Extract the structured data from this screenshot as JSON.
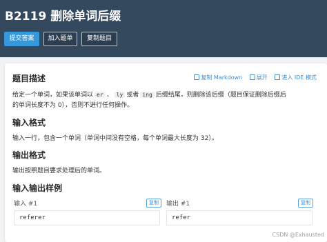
{
  "header": {
    "title": "B2119 删除单词后缀",
    "buttons": {
      "submit": "提交答案",
      "add_to_list": "加入题单",
      "copy_problem": "复制题目"
    }
  },
  "actions": {
    "copy_markdown": "复制 Markdown",
    "expand": "展开",
    "ide_mode": "进入 IDE 模式"
  },
  "sections": {
    "description": {
      "heading": "题目描述",
      "line1_pre": "给定一个单词，如果该单词以",
      "code_er": "er",
      "sep1": "、",
      "code_ly": "ly",
      "mid_or": "或者",
      "code_ing": "ing",
      "line1_post": "后缀结尾，则删除该后缀（题目保证删除后缀后",
      "line2": "的单词长度不为 0），否则不进行任何操作。"
    },
    "input_format": {
      "heading": "输入格式",
      "text": "输入一行，包含一个单词（单词中间没有空格，每个单词最大长度为 32）。"
    },
    "output_format": {
      "heading": "输出格式",
      "text": "输出按照题目要求处理后的单词。"
    },
    "samples": {
      "heading": "输入输出样例",
      "input_label": "输入 #1",
      "output_label": "输出 #1",
      "copy_label": "复制",
      "input_value": "referer",
      "output_value": "refer"
    }
  },
  "watermark": "CSDN @Exhausted"
}
